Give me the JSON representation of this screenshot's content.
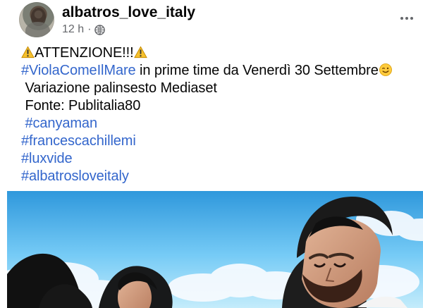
{
  "post": {
    "author": "albatros_love_italy",
    "time": "12 h",
    "separator": "·",
    "privacy_icon": "globe-icon",
    "more_icon": "more-horizontal-icon",
    "text": {
      "alert": "ATTENZIONE!!!",
      "show_tag": "#ViolaComeIlMare",
      "schedule_text": " in prime time da Venerdì 30 Settembre",
      "variation": "Variazione palinsesto Mediaset",
      "source": "Fonte: Publitalia80",
      "hashtags": [
        "#canyaman",
        "#francescachillemi",
        "#luxvide",
        "#albatrosloveitaly"
      ]
    },
    "icons": {
      "warning": "warning-emoji-icon",
      "wink": "wink-emoji-icon"
    },
    "photo": {
      "subject": "post-photo"
    }
  },
  "colors": {
    "text": "#050505",
    "secondary": "#65676b",
    "hashtag": "#3366cc",
    "sky": "#3bb0ef"
  }
}
